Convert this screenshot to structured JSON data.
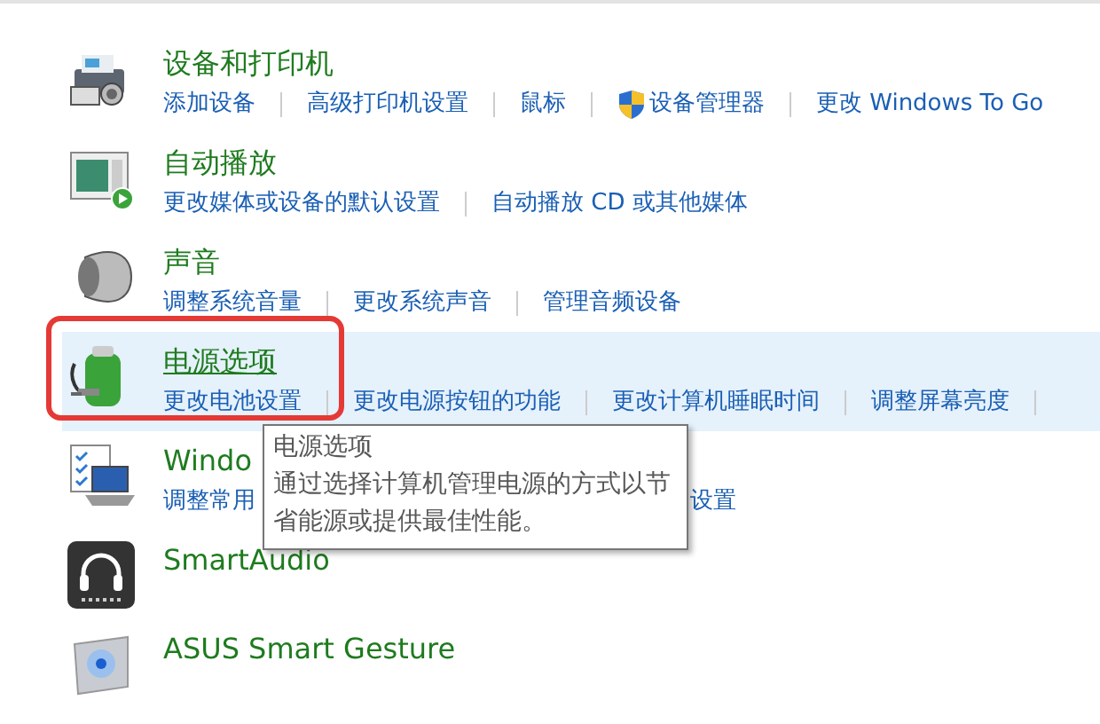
{
  "items": [
    {
      "title": "设备和打印机",
      "hovered": false,
      "highlighted": false,
      "links": [
        {
          "text": "添加设备"
        },
        {
          "text": "高级打印机设置"
        },
        {
          "text": "鼠标"
        },
        {
          "text": "设备管理器",
          "kind": "admin"
        },
        {
          "text": "更改 Windows To Go"
        }
      ]
    },
    {
      "title": "自动播放",
      "hovered": false,
      "highlighted": false,
      "links": [
        {
          "text": "更改媒体或设备的默认设置"
        },
        {
          "text": "自动播放 CD 或其他媒体"
        }
      ]
    },
    {
      "title": "声音",
      "hovered": false,
      "highlighted": false,
      "links": [
        {
          "text": "调整系统音量"
        },
        {
          "text": "更改系统声音"
        },
        {
          "text": "管理音频设备"
        }
      ]
    },
    {
      "title": "电源选项",
      "hovered": true,
      "highlighted": true,
      "links": [
        {
          "text": "更改电池设置"
        },
        {
          "text": "更改电源按钮的功能"
        },
        {
          "text": "更改计算机睡眠时间"
        },
        {
          "text": "调整屏幕亮度"
        }
      ]
    },
    {
      "title": "Windo",
      "hovered": false,
      "highlighted": false,
      "links": [
        {
          "text": "调整常用"
        },
        {
          "text": "设置"
        }
      ]
    },
    {
      "title": "SmartAudio",
      "hovered": false,
      "highlighted": false
    },
    {
      "title": "ASUS Smart Gesture",
      "hovered": false,
      "highlighted": false
    }
  ],
  "tooltip": {
    "title": "电源选项",
    "text": "通过选择计算机管理电源的方式以节省能源或提供最佳性能。"
  }
}
